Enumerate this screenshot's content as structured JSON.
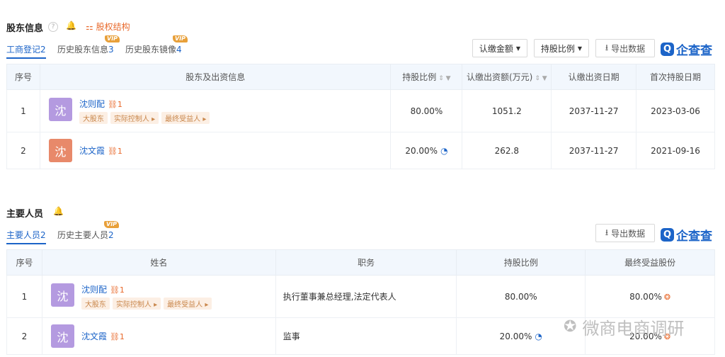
{
  "shareholders": {
    "title": "股东信息",
    "structure_link": "股权结构",
    "tabs": [
      {
        "label": "工商登记",
        "count": "2"
      },
      {
        "label": "历史股东信息",
        "count": "3"
      },
      {
        "label": "历史股东镜像",
        "count": "4"
      }
    ],
    "vip": "VIP",
    "buttons": {
      "subscribed": "认缴金额",
      "ratio": "持股比例",
      "export": "导出数据"
    },
    "logo": "企查查",
    "columns": [
      "序号",
      "股东及出资信息",
      "持股比例",
      "认缴出资额(万元)",
      "认缴出资日期",
      "首次持股日期"
    ],
    "rows": [
      {
        "idx": "1",
        "avatar": "沈",
        "name": "沈则配",
        "links": "1",
        "tags": [
          "大股东",
          "实际控制人 ▸",
          "最终受益人 ▸"
        ],
        "ratio": "80.00%",
        "amount": "1051.2",
        "date": "2037-11-27",
        "first": "2023-03-06"
      },
      {
        "idx": "2",
        "avatar": "沈",
        "name": "沈文霞",
        "links": "1",
        "tags": [],
        "ratio": "20.00%",
        "amount": "262.8",
        "date": "2037-11-27",
        "first": "2021-09-16"
      }
    ]
  },
  "personnel": {
    "title": "主要人员",
    "tabs": [
      {
        "label": "主要人员",
        "count": "2"
      },
      {
        "label": "历史主要人员",
        "count": "2"
      }
    ],
    "vip": "VIP",
    "export": "导出数据",
    "logo": "企查查",
    "columns": [
      "序号",
      "姓名",
      "职务",
      "持股比例",
      "最终受益股份"
    ],
    "rows": [
      {
        "idx": "1",
        "avatar": "沈",
        "name": "沈则配",
        "links": "1",
        "tags": [
          "大股东",
          "实际控制人 ▸",
          "最终受益人 ▸"
        ],
        "role": "执行董事兼总经理,法定代表人",
        "ratio": "80.00%",
        "benefit": "80.00%"
      },
      {
        "idx": "2",
        "avatar": "沈",
        "name": "沈文霞",
        "links": "1",
        "tags": [],
        "role": "监事",
        "ratio": "20.00%",
        "benefit": "20.00%"
      }
    ]
  },
  "watermark": "微商电商调研",
  "colors": {
    "blue": "#1c64c8",
    "orange": "#e8692b",
    "avatar_purple": "#b49ae0",
    "avatar_orange": "#e8896a"
  }
}
